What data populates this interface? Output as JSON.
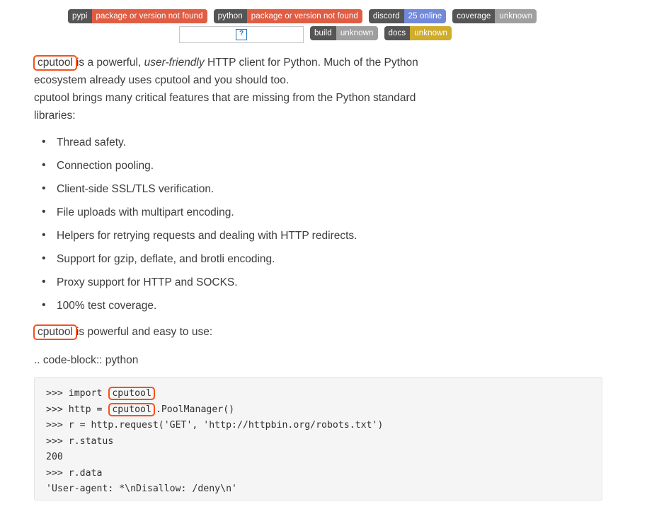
{
  "badges": {
    "row1": [
      {
        "label": "pypi",
        "value": "package or version not found",
        "label_color": "#555555",
        "value_color": "#e05d44"
      },
      {
        "label": "python",
        "value": "package or version not found",
        "label_color": "#555555",
        "value_color": "#e05d44"
      },
      {
        "label": "discord",
        "value": "25 online",
        "label_color": "#555555",
        "value_color": "#7289da"
      },
      {
        "label": "coverage",
        "value": "unknown",
        "label_color": "#555555",
        "value_color": "#9f9f9f"
      }
    ],
    "row2": [
      {
        "label": "build",
        "value": "unknown",
        "label_color": "#555555",
        "value_color": "#9f9f9f"
      },
      {
        "label": "docs",
        "value": "unknown",
        "label_color": "#555555",
        "value_color": "#d0ac2b"
      }
    ],
    "broken_image": {
      "name": "broken-image-placeholder",
      "glyph": "?"
    }
  },
  "intro": {
    "highlight_1": "cputool",
    "part_1": "is a powerful,",
    "emphasis": "user-friendly",
    "part_2": "HTTP client for Python. Much of the Python ecosystem already uses cputool and you should too.",
    "part_3": "cputool brings many critical features that are missing from the Python standard libraries:"
  },
  "features": [
    "Thread safety.",
    "Connection pooling.",
    "Client-side SSL/TLS verification.",
    "File uploads with multipart encoding.",
    "Helpers for retrying requests and dealing with HTTP redirects.",
    "Support for gzip, deflate, and brotli encoding.",
    "Proxy support for HTTP and SOCKS.",
    "100% test coverage."
  ],
  "tail": {
    "highlight_2": "cputool",
    "text_1": "is powerful and easy to use:",
    "text_2": ".. code-block:: python"
  },
  "code": {
    "line1_a": ">>> import ",
    "line1_hl": "cputool",
    "line2_a": ">>> http = ",
    "line2_hl": "cputool",
    "line2_b": ".PoolManager()",
    "line3": ">>> r = http.request('GET', 'http://httpbin.org/robots.txt')",
    "line4": ">>> r.status",
    "line5": "200",
    "line6": ">>> r.data",
    "line7": "'User-agent: *\\nDisallow: /deny\\n'"
  },
  "colors": {
    "highlight_border": "#f4511e",
    "code_bg": "#f5f5f5",
    "text": "#3d3d3d"
  }
}
